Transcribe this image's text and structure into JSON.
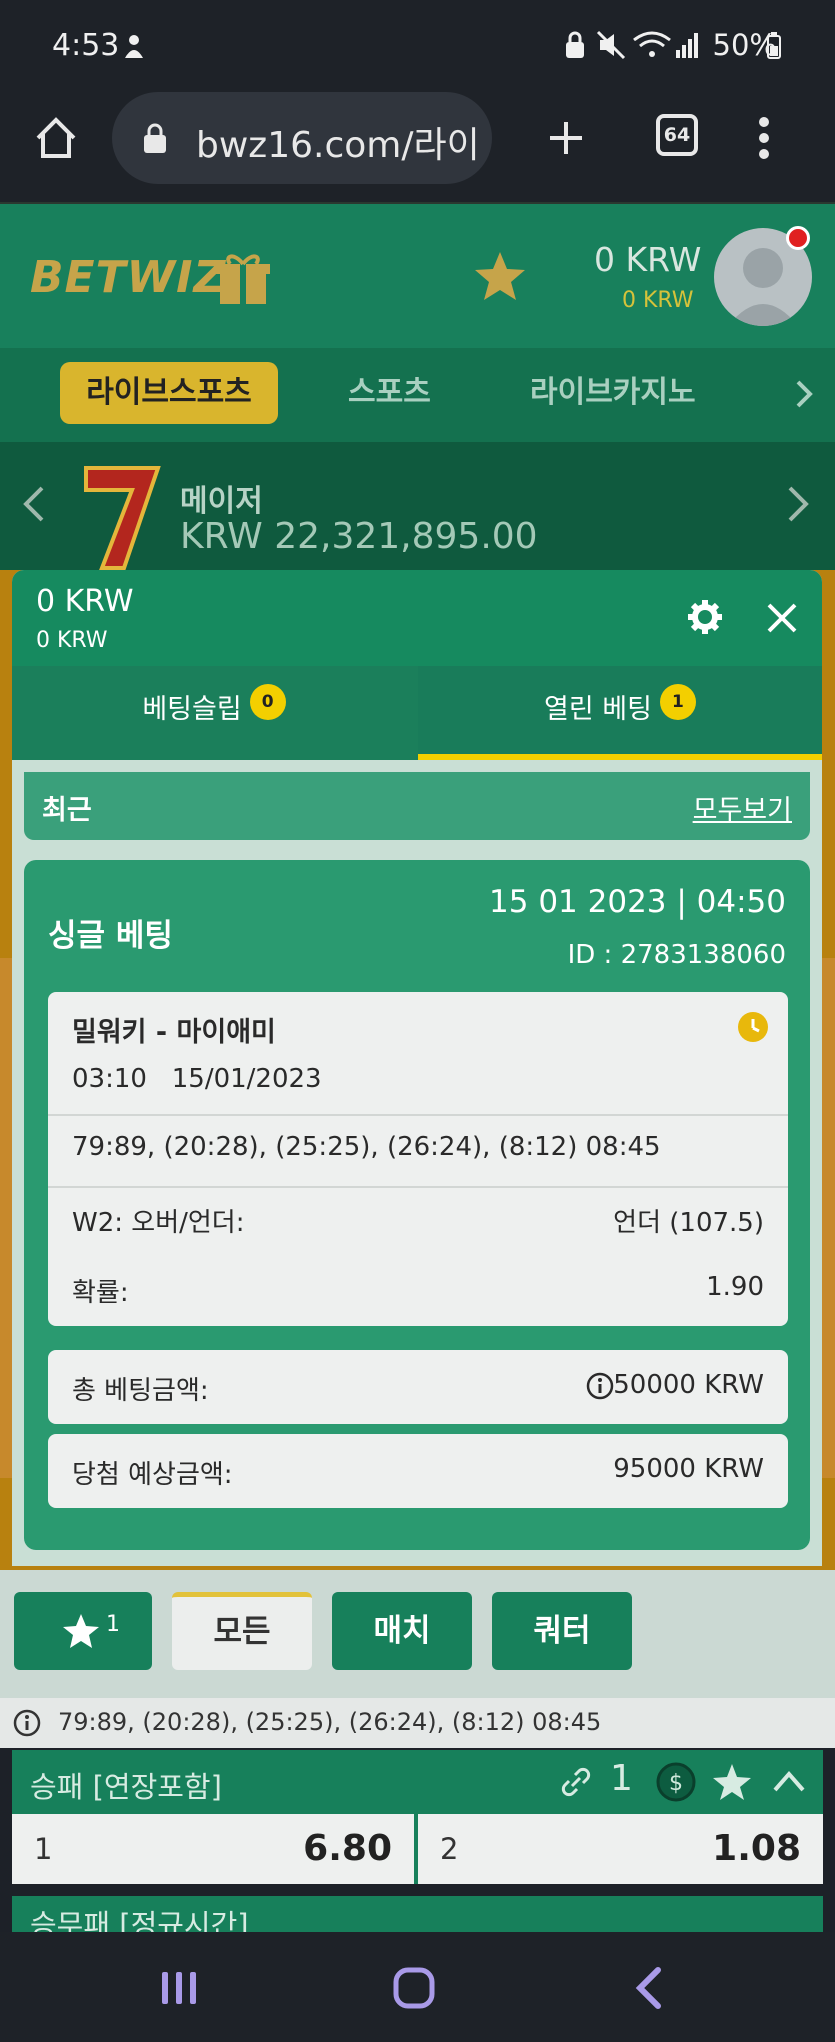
{
  "status_bar": {
    "time": "4:53",
    "battery": "50%"
  },
  "browser": {
    "url": "bwz16.com/라이",
    "tab_count": "64"
  },
  "header": {
    "logo": "BETWIZ",
    "balance_main": "0 KRW",
    "balance_bonus": "0 KRW"
  },
  "nav": {
    "items": [
      "라이브스포츠",
      "스포츠",
      "라이브카지노"
    ]
  },
  "jackpot": {
    "title": "메이저",
    "amount": "KRW 22,321,895.00"
  },
  "betslip": {
    "balance_main": "0 KRW",
    "balance_bonus": "0 KRW",
    "tabs": [
      {
        "label": "베팅슬립",
        "badge": "0"
      },
      {
        "label": "열린 베팅",
        "badge": "1"
      }
    ],
    "recent_label": "최근",
    "view_all": "모두보기",
    "bet": {
      "type": "싱글 베팅",
      "datetime": "15 01 2023 | 04:50",
      "id_label": "ID :",
      "id": "2783138060",
      "match": "밀워키 - 마이애미",
      "match_time": "03:10",
      "match_date": "15/01/2023",
      "score": "79:89, (20:28), (25:25), (26:24), (8:12) 08:45",
      "market": "W2: 오버/언더:",
      "selection": "언더 (107.5)",
      "prob_label": "확률:",
      "odds": "1.90",
      "stake_label": "총 베팅금액:",
      "stake": "50000 KRW",
      "win_label": "당첨 예상금액:",
      "win": "95000 KRW"
    }
  },
  "filters": {
    "fav_count": "1",
    "items": [
      "모든",
      "매치",
      "쿼터"
    ]
  },
  "info_line": "79:89, (20:28), (25:25), (26:24), (8:12) 08:45",
  "markets": [
    {
      "title": "승패 [연장포함]",
      "link_count": "1",
      "outcomes": [
        {
          "label": "1",
          "odds": "6.80"
        },
        {
          "label": "2",
          "odds": "1.08"
        }
      ]
    },
    {
      "title": "승무패 [정규시간]"
    }
  ]
}
